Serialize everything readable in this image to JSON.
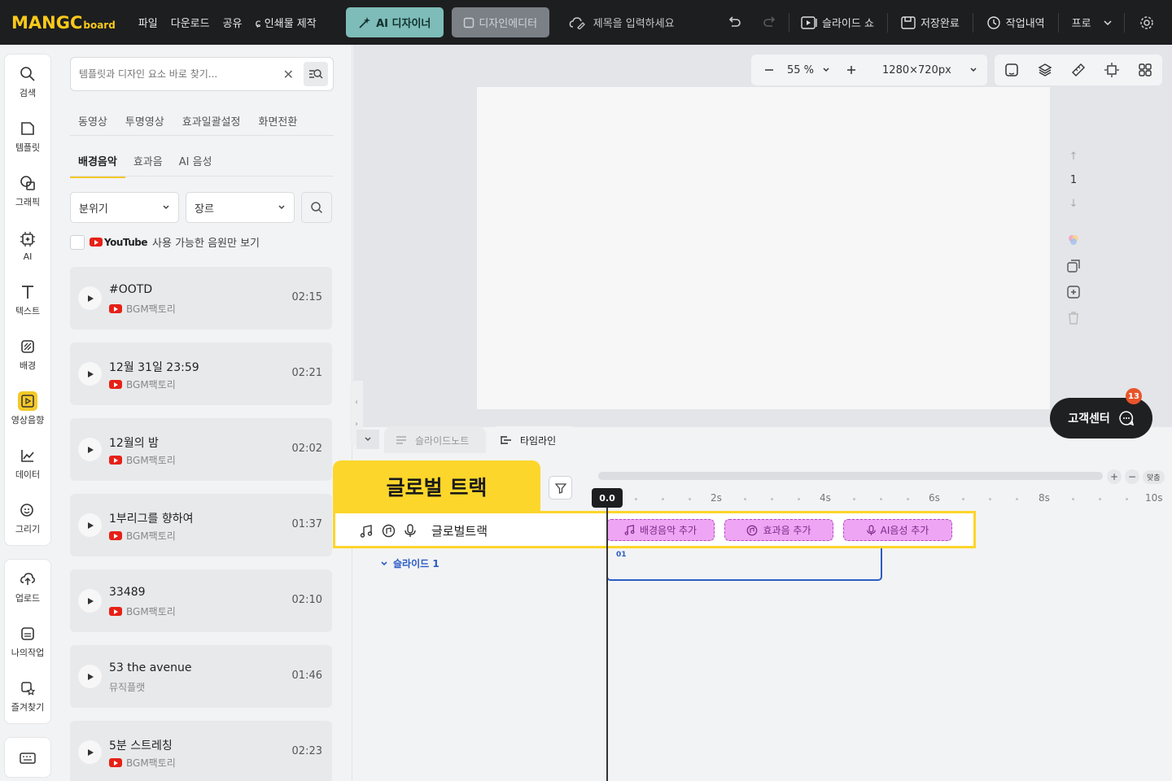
{
  "logo": {
    "main": "MANGC",
    "sub": "board"
  },
  "menu": [
    "파일",
    "다운로드",
    "공유",
    "인쇄물 제작"
  ],
  "ai_designer": "AI 디자이너",
  "design_editor": "디자인에디터",
  "title_placeholder": "제목을 입력하세요",
  "slideshow": "슬라이드 쇼",
  "save_status": "저장완료",
  "history": "작업내역",
  "plan": "프로",
  "rail": {
    "group1": [
      "검색",
      "템플릿",
      "그래픽",
      "AI",
      "텍스트",
      "배경",
      "영상음향",
      "데이터",
      "그리기"
    ],
    "group2": [
      "업로드",
      "나의작업",
      "즐겨찾기"
    ]
  },
  "search": {
    "placeholder": "템플릿과 디자인 요소 바로 찾기..."
  },
  "tabs_top": [
    "동영상",
    "투명영상",
    "효과일괄설정",
    "화면전환"
  ],
  "tabs_sub": [
    "배경음악",
    "효과음",
    "AI 음성"
  ],
  "filters": {
    "mood": "분위기",
    "genre": "장르"
  },
  "youtube": {
    "brand": "YouTube",
    "label": "사용 가능한 음원만 보기"
  },
  "tracks": [
    {
      "name": "#OOTD",
      "source": "BGM팩토리",
      "duration": "02:15"
    },
    {
      "name": "12월 31일 23:59",
      "source": "BGM팩토리",
      "duration": "02:21"
    },
    {
      "name": "12월의 밤",
      "source": "BGM팩토리",
      "duration": "02:02"
    },
    {
      "name": "1부리그를 향하여",
      "source": "BGM팩토리",
      "duration": "01:37"
    },
    {
      "name": "33489",
      "source": "BGM팩토리",
      "duration": "02:10"
    },
    {
      "name": "53 the avenue",
      "source": "뮤직플랫",
      "duration": "01:46"
    },
    {
      "name": "5분 스트레칭",
      "source": "BGM팩토리",
      "duration": "02:23"
    }
  ],
  "zoom": {
    "level": "55 %",
    "size": "1280×720px"
  },
  "page_number": "1",
  "help": {
    "label": "고객센터",
    "badge": "13"
  },
  "bottom_tabs": {
    "notes": "슬라이드노트",
    "timeline": "타임라인"
  },
  "timeline": {
    "playhead": "0.0",
    "ticks": [
      "2s",
      "4s",
      "6s",
      "8s",
      "10s"
    ],
    "fit": "맞춤",
    "callout": "글로벌 트랙",
    "global_track": "글로벌트랙",
    "chips": [
      "배경음악 추가",
      "효과음 추가",
      "AI음성 추가"
    ],
    "slide": "슬라이드 1",
    "clip_number": "01"
  },
  "colors": {
    "accent": "#f4c928",
    "topbar": "#1d1e20",
    "chip": "#eea5f3",
    "timeline_blue": "#2c5cc5"
  }
}
